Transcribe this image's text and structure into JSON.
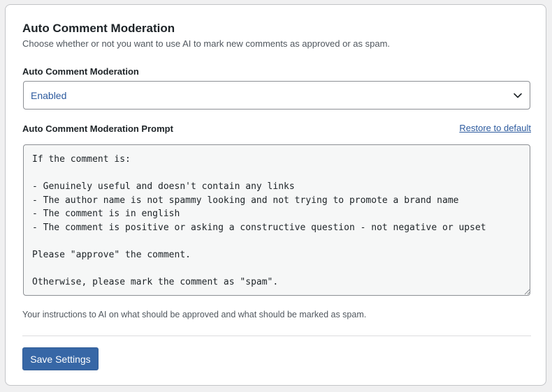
{
  "section": {
    "title": "Auto Comment Moderation",
    "description": "Choose whether or not you want to use AI to mark new comments as approved or as spam."
  },
  "moderation_field": {
    "label": "Auto Comment Moderation",
    "selected_value": "Enabled"
  },
  "prompt_field": {
    "label": "Auto Comment Moderation Prompt",
    "restore_label": "Restore to default",
    "value": "If the comment is:\n\n- Genuinely useful and doesn't contain any links\n- The author name is not spammy looking and not trying to promote a brand name\n- The comment is in english\n- The comment is positive or asking a constructive question - not negative or upset\n\nPlease \"approve\" the comment.\n\nOtherwise, please mark the comment as \"spam\".",
    "help_text": "Your instructions to AI on what should be approved and what should be marked as spam."
  },
  "actions": {
    "save_label": "Save Settings"
  },
  "icons": {
    "select_toggle": "chevron-down-icon",
    "resize": "resize-grip-icon"
  },
  "colors": {
    "primary": "#3767a6",
    "link": "#2c5a9e",
    "textarea_bg": "#f6f7f7"
  }
}
